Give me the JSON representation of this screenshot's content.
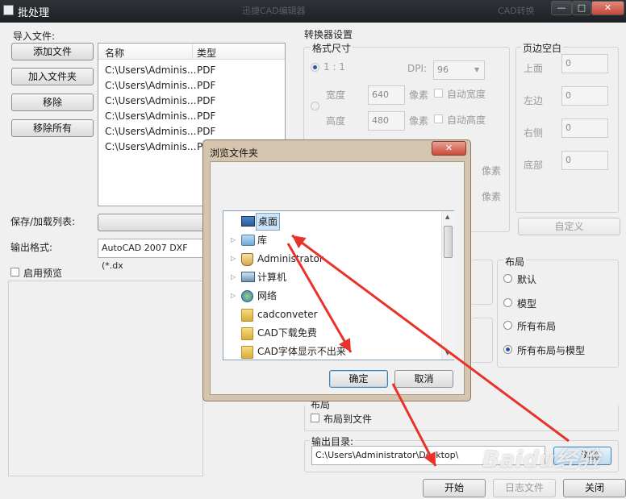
{
  "window": {
    "title": "批处理",
    "bg_title": "迅捷CAD编辑器",
    "bg_title_right": "CAD转换"
  },
  "left": {
    "import_label": "导入文件:",
    "buttons": {
      "add_file": "添加文件",
      "add_folder": "加入文件夹",
      "remove": "移除",
      "remove_all": "移除所有"
    },
    "file_list": {
      "headers": [
        "名称",
        "类型"
      ],
      "rows": [
        [
          "C:\\Users\\Adminis...",
          "PDF"
        ],
        [
          "C:\\Users\\Adminis...",
          "PDF"
        ],
        [
          "C:\\Users\\Adminis...",
          "PDF"
        ],
        [
          "C:\\Users\\Adminis...",
          "PDF"
        ],
        [
          "C:\\Users\\Adminis...",
          "PDF"
        ],
        [
          "C:\\Users\\Adminis...",
          "P"
        ]
      ]
    },
    "save_load_label": "保存/加载列表:",
    "output_format_label": "输出格式:",
    "output_format_value": "AutoCAD 2007 DXF (*.dx",
    "enable_preview": "启用预览"
  },
  "converter": {
    "title": "转换器设置",
    "format_size": "格式尺寸",
    "ratio": "1 : 1",
    "dpi_label": "DPI:",
    "dpi_value": "96",
    "width_label": "宽度",
    "width_value": "640",
    "height_label": "高度",
    "height_value": "480",
    "pixel": "像素",
    "auto_width": "自动宽度",
    "auto_height": "自动高度",
    "margins": {
      "title": "页边空白",
      "top": "上面",
      "top_value": "0",
      "left": "左边",
      "left_value": "0",
      "right": "右侧",
      "right_value": "0",
      "bottom": "底部",
      "bottom_value": "0"
    },
    "custom_button": "自定义",
    "layout": {
      "title": "布局",
      "options": [
        "默认",
        "模型",
        "所有布局",
        "所有布局与模型"
      ],
      "selected": 3
    },
    "layout2_title": "布局",
    "layout_to_file": "布局到文件",
    "output_dir_label": "输出目录:",
    "output_dir_value": "C:\\Users\\Administrator\\Desktop\\",
    "browse_button": "浏览"
  },
  "bottom": {
    "start": "开始",
    "log": "日志文件",
    "close": "关闭"
  },
  "dialog": {
    "title": "浏览文件夹",
    "tree": [
      {
        "label": "桌面",
        "icon": "desktop-icon",
        "expand": false,
        "selected": true
      },
      {
        "label": "库",
        "icon": "library-icon",
        "expand": true
      },
      {
        "label": "Administrator",
        "icon": "user-icon",
        "expand": true
      },
      {
        "label": "计算机",
        "icon": "computer-icon",
        "expand": true
      },
      {
        "label": "网络",
        "icon": "network-icon",
        "expand": true
      },
      {
        "label": "cadconveter",
        "icon": "folder-icon",
        "expand": false
      },
      {
        "label": "CAD下载免费",
        "icon": "folder-icon",
        "expand": false
      },
      {
        "label": "CAD字体显示不出来",
        "icon": "folder-icon",
        "expand": false
      }
    ],
    "ok": "确定",
    "cancel": "取消"
  },
  "watermark": "Baidu经验",
  "colors": {
    "annotation_arrow": "#e8332b",
    "selection": "#cce4f7"
  }
}
